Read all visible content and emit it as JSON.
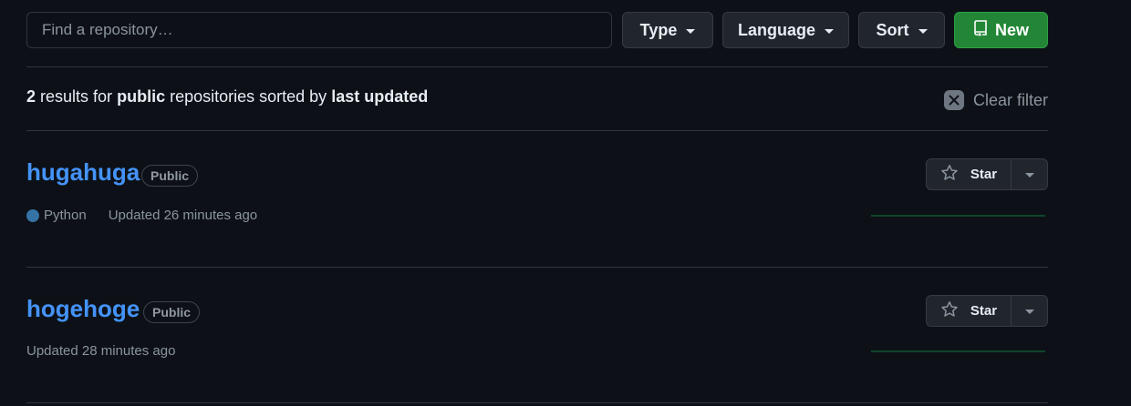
{
  "toolbar": {
    "search_placeholder": "Find a repository…",
    "type_label": "Type",
    "language_label": "Language",
    "sort_label": "Sort",
    "new_label": "New"
  },
  "results": {
    "count": "2",
    "text_results_for": "results for",
    "filter": "public",
    "text_repos_sorted_by": "repositories sorted by",
    "sort": "last updated",
    "clear_filter_label": "Clear filter"
  },
  "repos": [
    {
      "name": "hugahuga",
      "visibility": "Public",
      "language": "Python",
      "language_color": "#3572a5",
      "updated": "Updated 26 minutes ago",
      "star_label": "Star"
    },
    {
      "name": "hogehoge",
      "visibility": "Public",
      "updated": "Updated 28 minutes ago",
      "star_label": "Star"
    }
  ],
  "colors": {
    "background": "#0d1117",
    "link": "#4493f8",
    "new_button": "#238636",
    "activity_graph": "#0e4429"
  }
}
